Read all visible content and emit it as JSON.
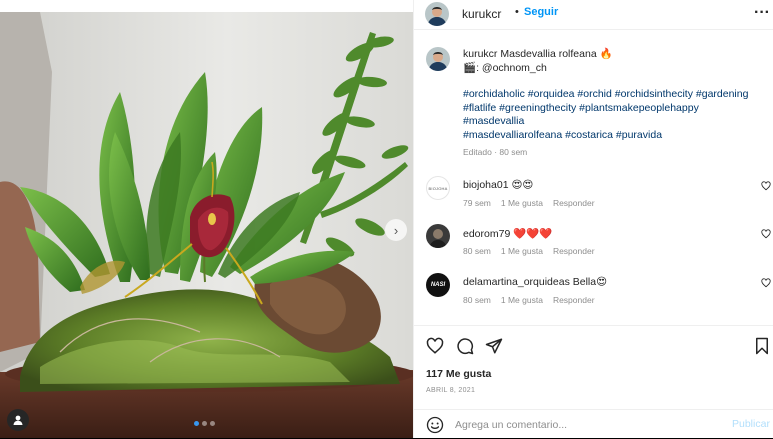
{
  "post": {
    "username": "kurukcr",
    "separator": "•",
    "follow_label": "Seguir",
    "more_icon": "more-horizontal-icon"
  },
  "caption": {
    "username": "kurukcr",
    "title": "Masdevallia rolfeana",
    "title_emoji": "🔥",
    "credit_icon": "clapperboard-icon",
    "credit": ": @ochnom_ch",
    "hashtags_1": "#orchidaholic #orquidea #orchid #orchidsinthecity #gardening",
    "hashtags_2": "#flatlife #greeningthecity #plantsmakepeoplehappy",
    "hashtags_3": "#masdevallia",
    "hashtags_4": "#masdevalliarolfeana #costarica #puravida",
    "meta": "Editado · 80 sem"
  },
  "comments": [
    {
      "username": "biojoha01",
      "text": "😍😍",
      "time": "79 sem",
      "likes": "1 Me gusta",
      "reply": "Responder",
      "avatar_text": "BIOJOHA"
    },
    {
      "username": "edorom79",
      "text": "❤️❤️❤️",
      "time": "80 sem",
      "likes": "1 Me gusta",
      "reply": "Responder",
      "avatar_text": ""
    },
    {
      "username": "delamartina_orquideas",
      "text": "Bella😍",
      "time": "80 sem",
      "likes": "1 Me gusta",
      "reply": "Responder",
      "avatar_text": "NASI"
    }
  ],
  "actions": {
    "likes": "117 Me gusta",
    "date": "ABRIL 8, 2021",
    "comment_placeholder": "Agrega un comentario...",
    "post_label": "Publicar"
  },
  "carousel": {
    "slides": 3,
    "active": 1
  },
  "colors": {
    "link": "#0095f6",
    "hashtag": "#00376b",
    "muted": "#8e8e8e",
    "post_disabled": "#b2dffc"
  }
}
